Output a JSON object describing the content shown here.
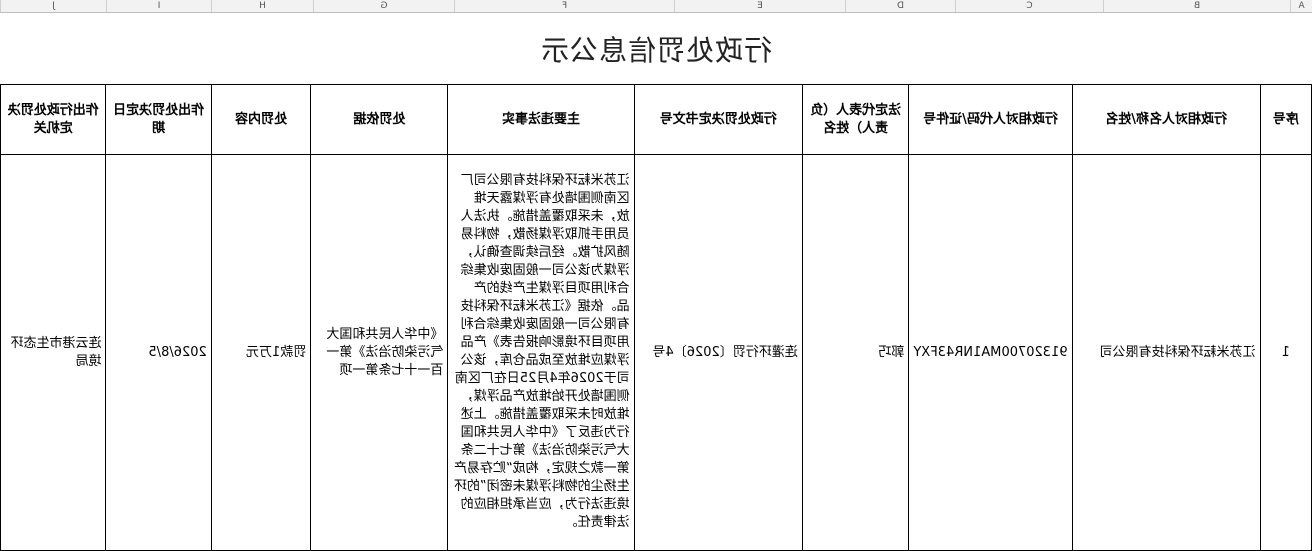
{
  "sheet": {
    "column_letters": [
      "A",
      "B",
      "C",
      "D",
      "E",
      "F",
      "G",
      "H",
      "I",
      "J"
    ]
  },
  "title": "行政处罚信息公示",
  "headers": [
    "序号",
    "行政相对人名称/姓名",
    "行政相对人代码/证件号",
    "法定代表人（负责人）姓名",
    "行政处罚决定书文号",
    "主要违法事实",
    "处罚依据",
    "处罚内容",
    "作出处罚决定日期",
    "作出行政处罚决定机关"
  ],
  "rows": [
    {
      "seq": "1",
      "party_name": "江苏米耘环保科技有限公司",
      "party_code": "91320700MA1NR43FXY",
      "legal_rep": "郭巧",
      "decision_no": "连灌环行罚〔2026〕4号",
      "facts": "江苏米耘环保科技有限公司厂区南侧围墙处有浮煤露天堆放，未采取覆盖措施。执法人员用手抓取浮煤扬散，物料易随风扩散。经后续调查确认，浮煤为该公司一般固废收集综合利用项目浮煤生产线的产品。依据《江苏米耘环保科技有限公司一般固废收集综合利用项目环境影响报告表》产品浮煤应堆放至成品仓库，该公司于2026年4月25日在厂区南侧围墙处开始堆放产品浮煤，堆放时未采取覆盖措施。上述行为违反了《中华人民共和国大气污染防治法》第七十二条第一款之规定，构成“贮存易产生扬尘的物料浮煤未密闭”的环境违法行为，应当承担相应的法律责任。",
      "basis": "《中华人民共和国大气污染防治法》第一百一十七条第一项",
      "penalty": "罚款1万元",
      "date": "2026/8/5",
      "authority": "连云港市生态环境局"
    }
  ]
}
